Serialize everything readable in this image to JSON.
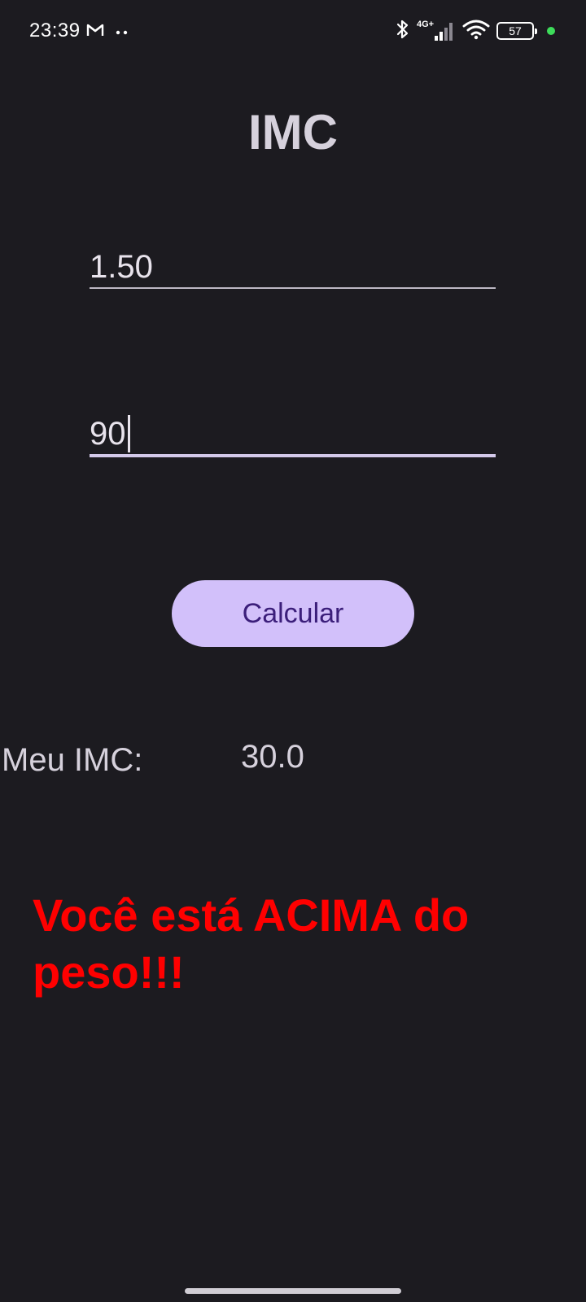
{
  "status_bar": {
    "time": "23:39",
    "battery_level": "57",
    "network_label": "4G+",
    "icons": [
      "gmail-icon",
      "more-dots-icon",
      "bluetooth-icon",
      "cellular-signal-icon",
      "wifi-icon",
      "battery-icon",
      "privacy-indicator-dot"
    ]
  },
  "app": {
    "title": "IMC",
    "height_field": {
      "value": "1.50"
    },
    "weight_field": {
      "value": "90"
    },
    "calculate_button": "Calcular",
    "result": {
      "label": "Meu IMC:",
      "value": "30.0"
    },
    "message": "Você está ACIMA do peso!!!"
  },
  "colors": {
    "background": "#1c1b20",
    "button_bg": "#d2c0fa",
    "button_text": "#3b1e7a",
    "message": "#ff0000",
    "text": "#d6d1dc"
  }
}
